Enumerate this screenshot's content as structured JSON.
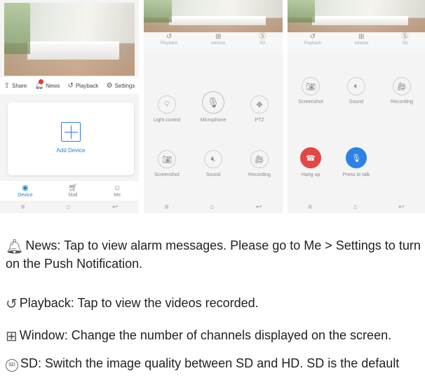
{
  "screen1": {
    "quick_bar": [
      {
        "icon": "share-icon",
        "label": "Share"
      },
      {
        "icon": "bell-icon",
        "label": "News"
      },
      {
        "icon": "history-icon",
        "label": "Playback"
      },
      {
        "icon": "gear-icon",
        "label": "Settings"
      }
    ],
    "add_device": "Add Device",
    "tabs": [
      {
        "icon": "camera-icon",
        "label": "Device"
      },
      {
        "icon": "cart-icon",
        "label": "Mall"
      },
      {
        "icon": "user-icon",
        "label": "Me"
      }
    ]
  },
  "toolbar": [
    {
      "icon": "history-icon",
      "label": "Playback"
    },
    {
      "icon": "grid-icon",
      "label": "window"
    },
    {
      "icon": "sd-icon",
      "label": "SD"
    }
  ],
  "screen2": {
    "controls": [
      {
        "icon": "bulb-icon",
        "label": "Light control"
      },
      {
        "icon": "microphone-icon",
        "label": "Microphone"
      },
      {
        "icon": "ptz-icon",
        "label": "PTZ"
      },
      {
        "icon": "camera-icon",
        "label": "Screenshot"
      },
      {
        "icon": "speaker-mute-icon",
        "label": "Sound"
      },
      {
        "icon": "video-record-icon",
        "label": "Recording"
      }
    ]
  },
  "screen3": {
    "controls": [
      {
        "icon": "camera-icon",
        "label": "Screenshot"
      },
      {
        "icon": "speaker-icon",
        "label": "Sound"
      },
      {
        "icon": "video-record-icon",
        "label": "Recording"
      },
      {
        "icon": "hang-up-icon",
        "label": "Hang up"
      },
      {
        "icon": "microphone-icon",
        "label": "Press to talk"
      }
    ]
  },
  "instructions": [
    {
      "icon": "bell-icon",
      "text": "News: Tap to view alarm messages. Please go to Me > Settings to turn on the Push Notification."
    },
    {
      "icon": "history-icon",
      "text": "Playback: Tap to view the videos recorded."
    },
    {
      "icon": "grid-icon",
      "text": "Window: Change the number of channels displayed on the screen."
    },
    {
      "icon": "sd-icon",
      "text": "SD: Switch the image quality between SD and HD. SD is the default"
    }
  ]
}
